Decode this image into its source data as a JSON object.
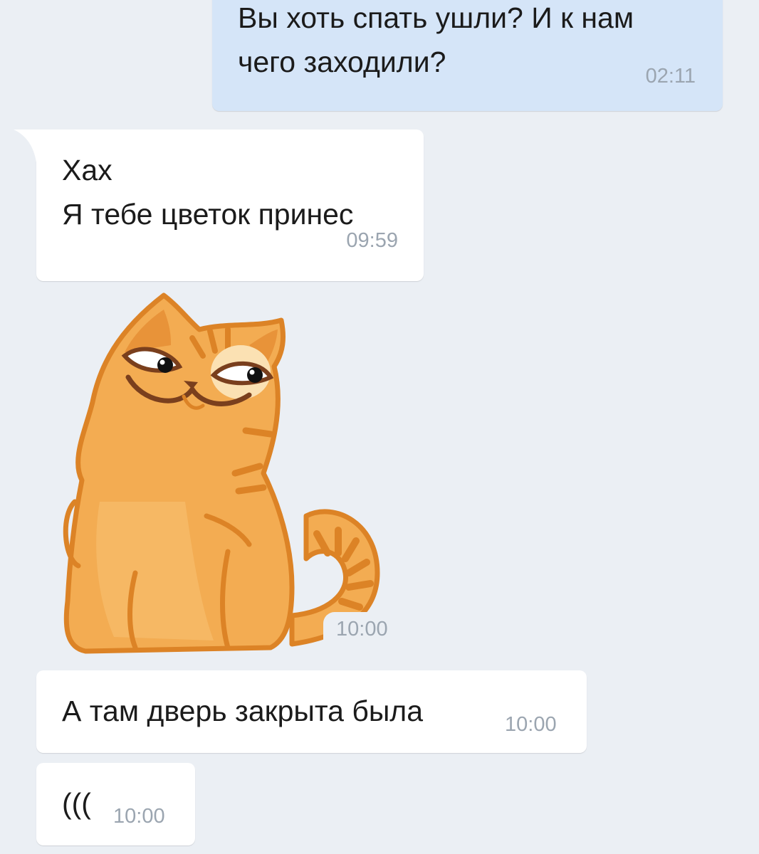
{
  "messages": [
    {
      "direction": "outgoing",
      "text": "Вы хоть спать ушли? И к нам\nчего заходили?",
      "time": "02:11"
    },
    {
      "direction": "incoming",
      "text": "Хах\nЯ тебе цветок принес",
      "time": "09:59"
    },
    {
      "direction": "incoming",
      "type": "sticker",
      "sticker": "smirking-orange-cat-sticker",
      "time": "10:00"
    },
    {
      "direction": "incoming",
      "text": "А там дверь закрыта была",
      "time": "10:00"
    },
    {
      "direction": "incoming",
      "text": "(((",
      "time": "10:00"
    }
  ],
  "colors": {
    "background": "#ebeff4",
    "incoming_bubble": "#ffffff",
    "outgoing_bubble": "#d5e5f8",
    "timestamp": "#9ba5b0",
    "text": "#1b1b1b"
  }
}
